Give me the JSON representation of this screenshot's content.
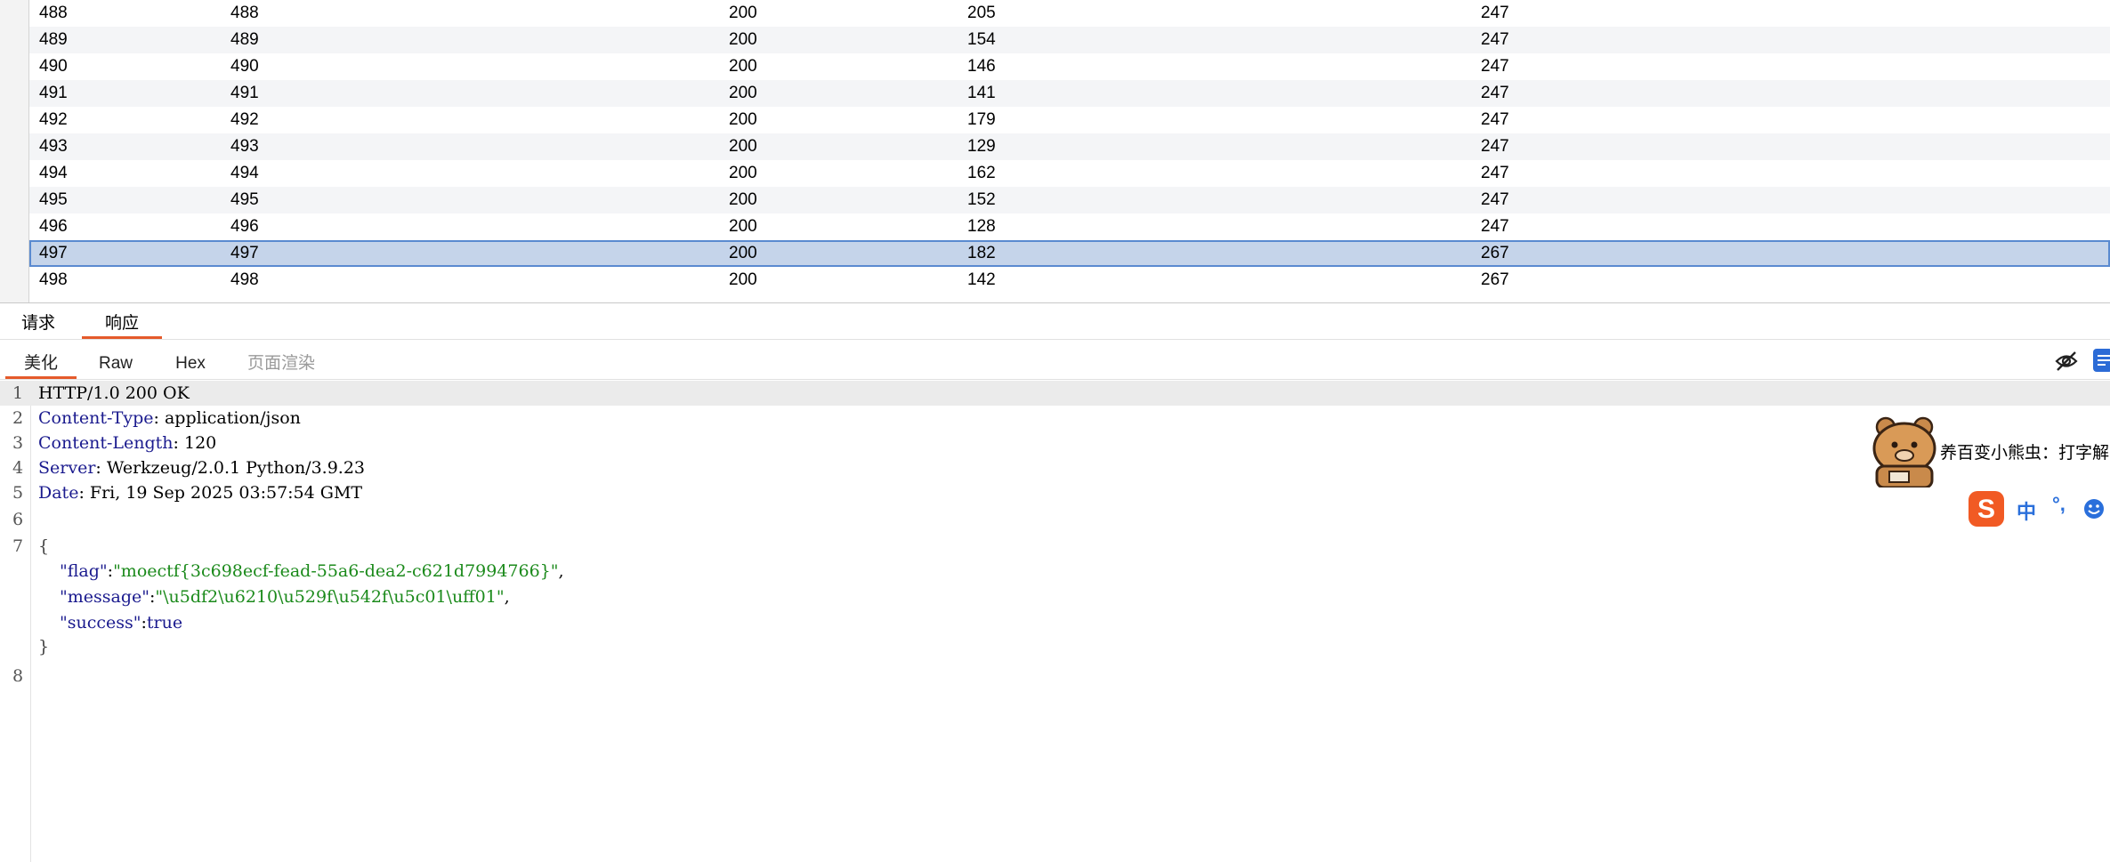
{
  "table": {
    "rows": [
      {
        "id": "488",
        "payload": "488",
        "status": "200",
        "time": "205",
        "length": "247"
      },
      {
        "id": "489",
        "payload": "489",
        "status": "200",
        "time": "154",
        "length": "247"
      },
      {
        "id": "490",
        "payload": "490",
        "status": "200",
        "time": "146",
        "length": "247"
      },
      {
        "id": "491",
        "payload": "491",
        "status": "200",
        "time": "141",
        "length": "247"
      },
      {
        "id": "492",
        "payload": "492",
        "status": "200",
        "time": "179",
        "length": "247"
      },
      {
        "id": "493",
        "payload": "493",
        "status": "200",
        "time": "129",
        "length": "247"
      },
      {
        "id": "494",
        "payload": "494",
        "status": "200",
        "time": "162",
        "length": "247"
      },
      {
        "id": "495",
        "payload": "495",
        "status": "200",
        "time": "152",
        "length": "247"
      },
      {
        "id": "496",
        "payload": "496",
        "status": "200",
        "time": "128",
        "length": "247"
      },
      {
        "id": "497",
        "payload": "497",
        "status": "200",
        "time": "182",
        "length": "267",
        "selected": true
      },
      {
        "id": "498",
        "payload": "498",
        "status": "200",
        "time": "142",
        "length": "267"
      }
    ]
  },
  "tabs": {
    "request": "请求",
    "response": "响应"
  },
  "view_tabs": {
    "pretty": "美化",
    "raw": "Raw",
    "hex": "Hex",
    "render": "页面渲染"
  },
  "response": {
    "line_numbers": [
      "1",
      "2",
      "3",
      "4",
      "5",
      "6",
      "7",
      "8"
    ],
    "status_line": "HTTP/1.0 200 OK",
    "headers": [
      {
        "name": "Content-Type",
        "value": "application/json"
      },
      {
        "name": "Content-Length",
        "value": "120"
      },
      {
        "name": "Server",
        "value": "Werkzeug/2.0.1 Python/3.9.23"
      },
      {
        "name": "Date",
        "value": "Fri, 19 Sep 2025 03:57:54 GMT"
      }
    ],
    "open_brace": "{",
    "close_brace": "}",
    "body": {
      "flag_key": "\"flag\"",
      "flag_value": "\"moectf{3c698ecf-fead-55a6-dea2-c621d7994766}\"",
      "message_key": "\"message\"",
      "message_value": "\"\\u5df2\\u6210\\u529f\\u542f\\u5c01\\uff01\"",
      "success_key": "\"success\"",
      "success_value": "true"
    }
  },
  "ime": {
    "tip": "养百变小熊虫：打字解",
    "mode": "中",
    "punct": "°,"
  },
  "colors": {
    "accent_tab": "#e55a2b",
    "selected_row": "#c5d4ea",
    "selected_border": "#5a8ad0",
    "header_name": "#1a1a8e",
    "string_value": "#1b8a1b"
  },
  "icons": {
    "hide": "eye-slash-icon",
    "wrap": "wrap-lines-icon",
    "ime": "sogou-icon",
    "emoji": "smiley-icon",
    "avatar": "bear-avatar-icon"
  }
}
